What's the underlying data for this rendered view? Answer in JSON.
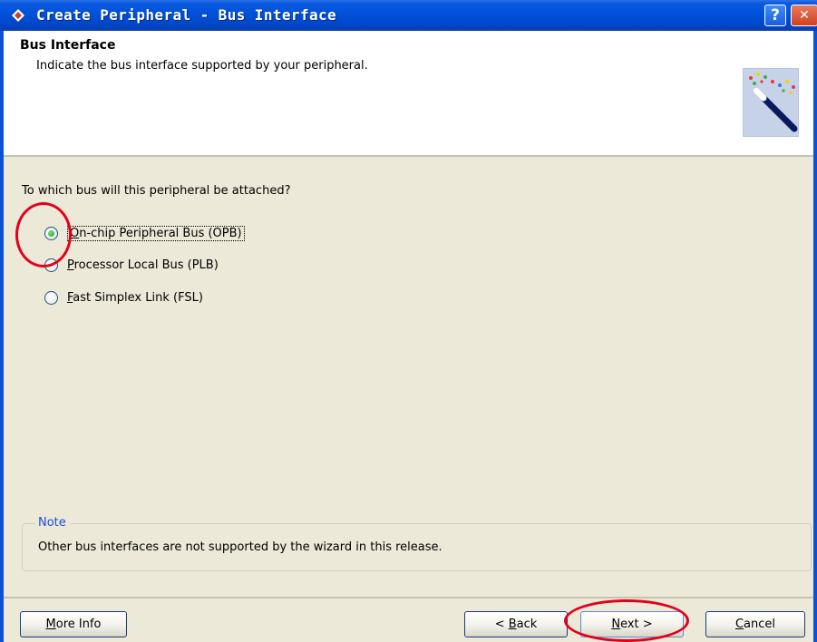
{
  "window": {
    "title": "Create Peripheral - Bus Interface",
    "help_label": "?",
    "close_label": "✕"
  },
  "header": {
    "title": "Bus Interface",
    "description": "Indicate the bus interface supported by your peripheral."
  },
  "content": {
    "question": "To which bus will this peripheral be attached?",
    "options": [
      {
        "accel": "O",
        "label_rest": "n-chip Peripheral Bus (OPB)",
        "selected": true
      },
      {
        "accel": "P",
        "label_rest": "rocessor Local Bus (PLB)",
        "selected": false
      },
      {
        "accel": "F",
        "label_rest": "ast Simplex Link (FSL)",
        "selected": false
      }
    ]
  },
  "note": {
    "legend": "Note",
    "text": "Other bus interfaces are not supported by the wizard in this release."
  },
  "buttons": {
    "more_info": {
      "accel": "M",
      "rest": "ore Info"
    },
    "back": {
      "prefix": "< ",
      "accel": "B",
      "rest": "ack"
    },
    "next": {
      "accel": "N",
      "rest": "ext >"
    },
    "cancel": {
      "accel": "C",
      "rest": "ancel"
    }
  },
  "colors": {
    "titlebar": "#0051d8",
    "dialog_bg": "#ece9d8",
    "annotation": "#e3001b",
    "note_legend": "#1a4fd8"
  },
  "icons": {
    "title": "app-icon",
    "header_art": "magic-wand-icon"
  }
}
